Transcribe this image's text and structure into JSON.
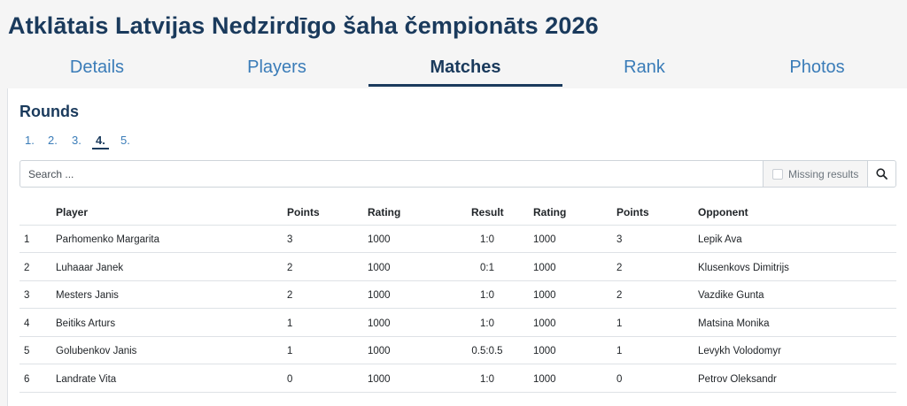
{
  "title": "Atklātais Latvijas Nedzirdīgo šaha čempionāts 2026",
  "tabs": [
    {
      "label": "Details"
    },
    {
      "label": "Players"
    },
    {
      "label": "Matches"
    },
    {
      "label": "Rank"
    },
    {
      "label": "Photos"
    }
  ],
  "rounds": {
    "heading": "Rounds",
    "items": [
      "1.",
      "2.",
      "3.",
      "4.",
      "5."
    ],
    "active": "4."
  },
  "search": {
    "placeholder": "Search ...",
    "missing_label": "Missing results"
  },
  "table": {
    "headers": [
      "",
      "Player",
      "Points",
      "Rating",
      "Result",
      "Rating",
      "Points",
      "Opponent"
    ],
    "rows": [
      [
        "1",
        "Parhomenko Margarita",
        "3",
        "1000",
        "1:0",
        "1000",
        "3",
        "Lepik Ava"
      ],
      [
        "2",
        "Luhaaar Janek",
        "2",
        "1000",
        "0:1",
        "1000",
        "2",
        "Klusenkovs Dimitrijs"
      ],
      [
        "3",
        "Mesters Janis",
        "2",
        "1000",
        "1:0",
        "1000",
        "2",
        "Vazdike Gunta"
      ],
      [
        "4",
        "Beitiks Arturs",
        "1",
        "1000",
        "1:0",
        "1000",
        "1",
        "Matsina Monika"
      ],
      [
        "5",
        "Golubenkov Janis",
        "1",
        "1000",
        "0.5:0.5",
        "1000",
        "1",
        "Levykh Volodomyr"
      ],
      [
        "6",
        "Landrate Vita",
        "0",
        "1000",
        "1:0",
        "1000",
        "0",
        "Petrov Oleksandr"
      ]
    ]
  }
}
